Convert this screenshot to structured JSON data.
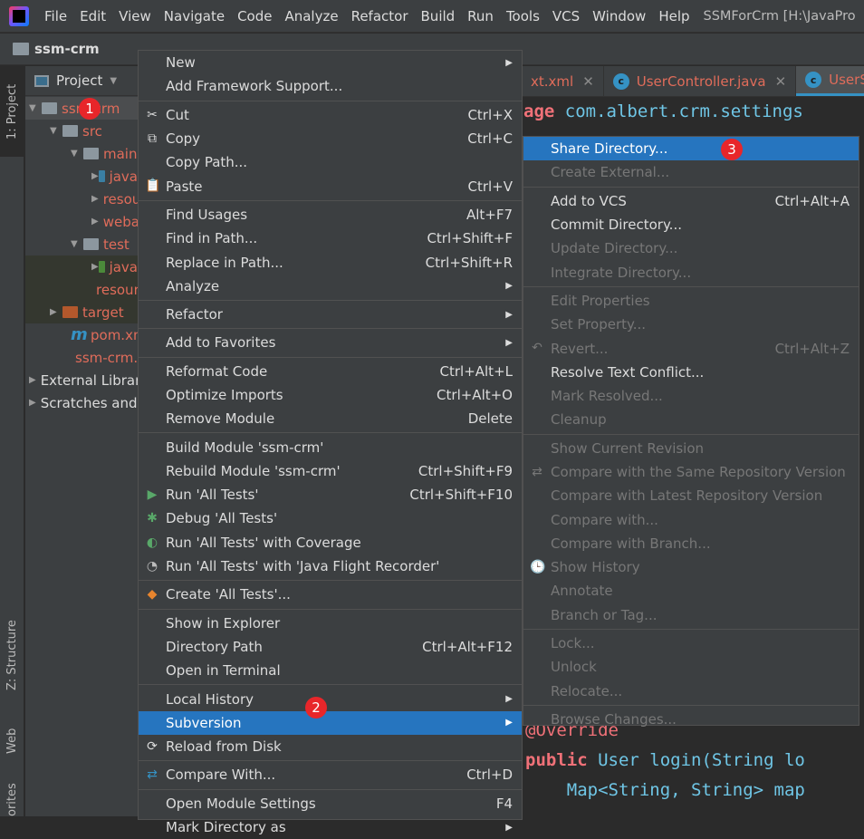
{
  "menubar": {
    "items": [
      {
        "label": "File"
      },
      {
        "label": "Edit"
      },
      {
        "label": "View"
      },
      {
        "label": "Navigate"
      },
      {
        "label": "Code"
      },
      {
        "label": "Analyze"
      },
      {
        "label": "Refactor"
      },
      {
        "label": "Build"
      },
      {
        "label": "Run"
      },
      {
        "label": "Tools"
      },
      {
        "label": "VCS"
      },
      {
        "label": "Window"
      },
      {
        "label": "Help"
      }
    ],
    "window_title": "SSMForCrm [H:\\JavaPro"
  },
  "navbar": {
    "project": "ssm-crm"
  },
  "left_strip": {
    "project_tab": "1: Project",
    "structure_tab": "Z: Structure",
    "web_tab": "Web",
    "favorites_tab": "orites"
  },
  "project_panel": {
    "title": "Project",
    "tree": [
      {
        "label": "ssm-crm",
        "depth": 0,
        "expanded": true,
        "icon": "module-folder",
        "color": "#e06c5a",
        "selected": true
      },
      {
        "label": "src",
        "depth": 1,
        "expanded": true,
        "icon": "folder",
        "color": "#e06c5a"
      },
      {
        "label": "main",
        "depth": 2,
        "expanded": true,
        "icon": "folder",
        "color": "#e06c5a"
      },
      {
        "label": "java",
        "depth": 3,
        "expanded": false,
        "icon": "source-folder",
        "color": "#e06c5a"
      },
      {
        "label": "resources",
        "depth": 3,
        "expanded": false,
        "icon": "resources-folder",
        "color": "#e06c5a"
      },
      {
        "label": "webapp",
        "depth": 3,
        "expanded": false,
        "icon": "web-folder",
        "color": "#e06c5a"
      },
      {
        "label": "test",
        "depth": 2,
        "expanded": true,
        "icon": "folder",
        "color": "#e06c5a"
      },
      {
        "label": "java",
        "depth": 3,
        "expanded": false,
        "icon": "test-folder",
        "color": "#e06c5a"
      },
      {
        "label": "resources",
        "depth": 3,
        "icon": "test-resources-folder",
        "color": "#e06c5a"
      },
      {
        "label": "target",
        "depth": 1,
        "expanded": false,
        "icon": "excluded-folder",
        "color": "#e06c5a"
      },
      {
        "label": "pom.xml",
        "depth": 2,
        "icon": "maven-file",
        "color": "#e06c5a"
      },
      {
        "label": "ssm-crm.iml",
        "depth": 2,
        "icon": "iml-file",
        "color": "#e06c5a"
      },
      {
        "label": "External Libraries",
        "depth": 0,
        "expanded": false,
        "icon": "libraries",
        "color": "#dcdcdc"
      },
      {
        "label": "Scratches and Consoles",
        "depth": 0,
        "expanded": false,
        "icon": "scratches",
        "color": "#dcdcdc"
      }
    ]
  },
  "editor": {
    "tabs": [
      {
        "label": "xt.xml"
      },
      {
        "label": "UserController.java"
      },
      {
        "label": "UserServ",
        "active": true
      }
    ],
    "code_top": {
      "kw": "age",
      "rest": " com.albert.crm.settings"
    },
    "code_bottom": [
      {
        "a": "@Override",
        "b": ""
      },
      {
        "a": "public",
        "b": " User login(String lo"
      },
      {
        "a": "    ",
        "b": "Map<String, String> map"
      }
    ]
  },
  "context_menu": {
    "items": [
      {
        "label": "New",
        "arrow": true
      },
      {
        "label": "Add Framework Support..."
      },
      {
        "sep": true
      },
      {
        "label": "Cut",
        "shortcut": "Ctrl+X",
        "icon": "✂",
        "iconname": "scissors-icon"
      },
      {
        "label": "Copy",
        "shortcut": "Ctrl+C",
        "icon": "⧉",
        "iconname": "copy-icon"
      },
      {
        "label": "Copy Path..."
      },
      {
        "label": "Paste",
        "shortcut": "Ctrl+V",
        "icon": "📋",
        "iconname": "paste-icon"
      },
      {
        "sep": true
      },
      {
        "label": "Find Usages",
        "shortcut": "Alt+F7"
      },
      {
        "label": "Find in Path...",
        "shortcut": "Ctrl+Shift+F"
      },
      {
        "label": "Replace in Path...",
        "shortcut": "Ctrl+Shift+R"
      },
      {
        "label": "Analyze",
        "arrow": true
      },
      {
        "sep": true
      },
      {
        "label": "Refactor",
        "arrow": true
      },
      {
        "sep": true
      },
      {
        "label": "Add to Favorites",
        "arrow": true
      },
      {
        "sep": true
      },
      {
        "label": "Reformat Code",
        "shortcut": "Ctrl+Alt+L"
      },
      {
        "label": "Optimize Imports",
        "shortcut": "Ctrl+Alt+O"
      },
      {
        "label": "Remove Module",
        "shortcut": "Delete"
      },
      {
        "sep": true
      },
      {
        "label": "Build Module 'ssm-crm'"
      },
      {
        "label": "Rebuild Module 'ssm-crm'",
        "shortcut": "Ctrl+Shift+F9"
      },
      {
        "label": "Run 'All Tests'",
        "shortcut": "Ctrl+Shift+F10",
        "icon": "▶",
        "iconname": "run-icon",
        "iconcolor": "#59a869"
      },
      {
        "label": "Debug 'All Tests'",
        "icon": "✱",
        "iconname": "debug-icon",
        "iconcolor": "#59a869"
      },
      {
        "label": "Run 'All Tests' with Coverage",
        "icon": "◐",
        "iconname": "coverage-icon",
        "iconcolor": "#59a869"
      },
      {
        "label": "Run 'All Tests' with 'Java Flight Recorder'",
        "icon": "◔",
        "iconname": "flight-recorder-icon",
        "iconcolor": "#bbbbbb"
      },
      {
        "sep": true
      },
      {
        "label": "Create 'All Tests'...",
        "icon": "◆",
        "iconname": "create-test-icon",
        "iconcolor": "#e8852e"
      },
      {
        "sep": true
      },
      {
        "label": "Show in Explorer"
      },
      {
        "label": "Directory Path",
        "shortcut": "Ctrl+Alt+F12"
      },
      {
        "label": "Open in Terminal"
      },
      {
        "sep": true
      },
      {
        "label": "Local History",
        "arrow": true
      },
      {
        "label": "Subversion",
        "arrow": true,
        "highlighted": true
      },
      {
        "label": "Reload from Disk",
        "icon": "⟳",
        "iconname": "reload-icon"
      },
      {
        "sep": true
      },
      {
        "label": "Compare With...",
        "shortcut": "Ctrl+D",
        "icon": "⇄",
        "iconname": "compare-icon",
        "iconcolor": "#3592c4"
      },
      {
        "sep": true
      },
      {
        "label": "Open Module Settings",
        "shortcut": "F4"
      },
      {
        "label": "Mark Directory as",
        "arrow": true
      }
    ]
  },
  "subversion_menu": {
    "items": [
      {
        "label": "Share Directory...",
        "highlighted": true
      },
      {
        "label": "Create External...",
        "disabled": true
      },
      {
        "sep": true
      },
      {
        "label": "Add to VCS",
        "shortcut": "Ctrl+Alt+A"
      },
      {
        "label": "Commit Directory..."
      },
      {
        "label": "Update Directory...",
        "disabled": true
      },
      {
        "label": "Integrate Directory...",
        "disabled": true
      },
      {
        "sep": true
      },
      {
        "label": "Edit Properties",
        "disabled": true
      },
      {
        "label": "Set Property...",
        "disabled": true
      },
      {
        "label": "Revert...",
        "shortcut": "Ctrl+Alt+Z",
        "disabled": true,
        "icon": "↶",
        "iconname": "revert-icon"
      },
      {
        "label": "Resolve Text Conflict..."
      },
      {
        "label": "Mark Resolved...",
        "disabled": true
      },
      {
        "label": "Cleanup",
        "disabled": true
      },
      {
        "sep": true
      },
      {
        "label": "Show Current Revision",
        "disabled": true
      },
      {
        "label": "Compare with the Same Repository Version",
        "disabled": true,
        "icon": "⇄",
        "iconname": "compare-icon"
      },
      {
        "label": "Compare with Latest Repository Version",
        "disabled": true
      },
      {
        "label": "Compare with...",
        "disabled": true
      },
      {
        "label": "Compare with Branch...",
        "disabled": true
      },
      {
        "label": "Show History",
        "disabled": true,
        "icon": "🕒",
        "iconname": "history-icon"
      },
      {
        "label": "Annotate",
        "disabled": true
      },
      {
        "label": "Branch or Tag...",
        "disabled": true
      },
      {
        "sep": true
      },
      {
        "label": "Lock...",
        "disabled": true
      },
      {
        "label": "Unlock",
        "disabled": true
      },
      {
        "label": "Relocate...",
        "disabled": true
      },
      {
        "sep": true
      },
      {
        "label": "Browse Changes...",
        "disabled": true
      }
    ]
  },
  "badges": [
    "1",
    "2",
    "3"
  ],
  "colors": {
    "accent": "#2675bf",
    "badge": "#e8262a",
    "menu_bg": "#3c3f41",
    "editor_bg": "#2b2b2b",
    "keyword": "#f07178",
    "identifier": "#6fc6e6"
  }
}
